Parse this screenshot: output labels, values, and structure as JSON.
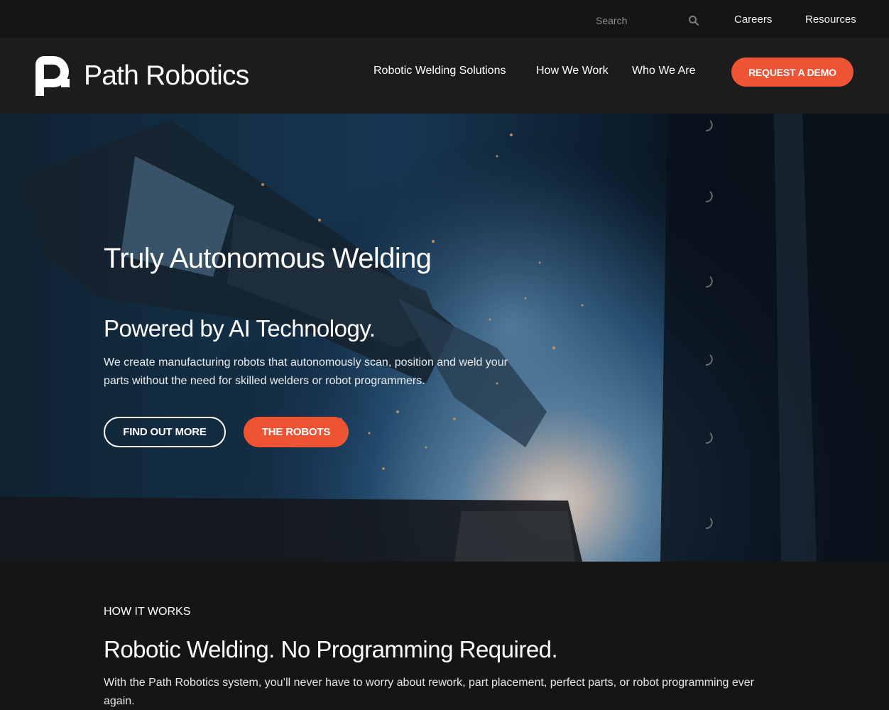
{
  "utility": {
    "search_placeholder": "Search",
    "links": [
      "Careers",
      "Resources"
    ]
  },
  "header": {
    "logo_text": "Path Robotics",
    "nav": [
      "Robotic Welding Solutions",
      "How We Work",
      "Who We Are"
    ],
    "cta": "REQUEST A DEMO"
  },
  "hero": {
    "title": "Truly Autonomous Welding",
    "subtitle": "Powered by AI Technology.",
    "description": "We create manufacturing robots that autonomously scan, position and weld your parts without the need for skilled welders or robot programmers.",
    "buttons": [
      "FIND OUT MORE",
      "THE ROBOTS"
    ]
  },
  "how_it_works": {
    "eyebrow": "HOW IT WORKS",
    "title": "Robotic Welding. No Programming Required.",
    "description": "With the Path Robotics system, you’ll never have to worry about rework, part placement, perfect parts, or robot programming ever again."
  },
  "colors": {
    "accent": "#ee5333",
    "background": "#161516",
    "nav_background": "#1d1c1d",
    "text": "#ffffff"
  },
  "icons": [
    "search-icon",
    "logo-mark-icon"
  ]
}
